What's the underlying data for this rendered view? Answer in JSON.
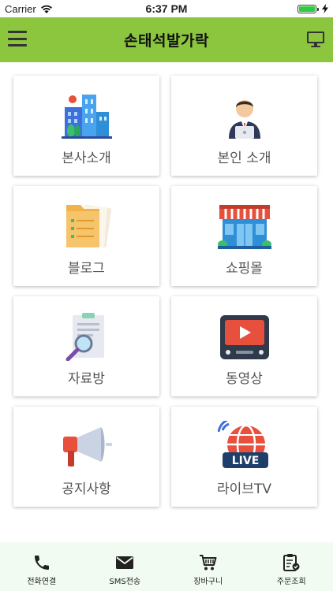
{
  "status_bar": {
    "carrier": "Carrier",
    "time": "6:37 PM",
    "battery_percent": 100
  },
  "header": {
    "title": "손태석발가락",
    "menu_icon": "hamburger-menu-icon",
    "right_icon": "desktop-monitor-icon"
  },
  "menu": [
    {
      "label": "본사소개",
      "icon": "company-building-icon"
    },
    {
      "label": "본인 소개",
      "icon": "person-laptop-icon"
    },
    {
      "label": "블로그",
      "icon": "folder-documents-icon"
    },
    {
      "label": "쇼핑몰",
      "icon": "storefront-icon"
    },
    {
      "label": "자료방",
      "icon": "document-magnifier-icon"
    },
    {
      "label": "동영상",
      "icon": "video-play-icon"
    },
    {
      "label": "공지사항",
      "icon": "megaphone-icon"
    },
    {
      "label": "라이브TV",
      "icon": "live-broadcast-icon"
    }
  ],
  "tabbar": [
    {
      "label": "전화연결",
      "icon": "phone-icon"
    },
    {
      "label": "SMS전송",
      "icon": "envelope-icon"
    },
    {
      "label": "장바구니",
      "icon": "shopping-cart-icon"
    },
    {
      "label": "주문조회",
      "icon": "order-clipboard-icon"
    }
  ],
  "colors": {
    "header_bg": "#8cc63f",
    "tabbar_bg": "#f2fbf2",
    "label_text": "#555555"
  }
}
